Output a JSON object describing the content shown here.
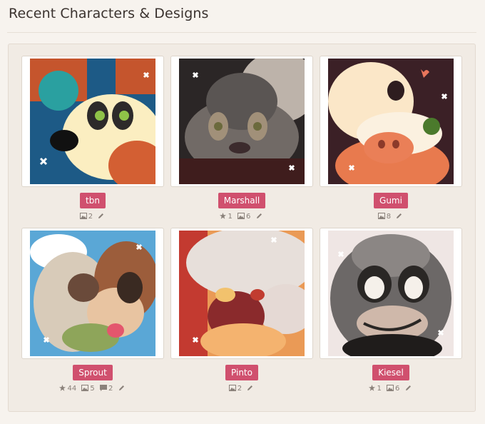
{
  "heading": "Recent Characters & Designs",
  "characters": [
    {
      "name": "tbn",
      "stats": {
        "images": "2"
      }
    },
    {
      "name": "Marshall",
      "stats": {
        "favorites": "1",
        "images": "6"
      }
    },
    {
      "name": "Gumi",
      "stats": {
        "images": "8"
      }
    },
    {
      "name": "Sprout",
      "stats": {
        "favorites": "44",
        "images": "5",
        "comments": "2"
      }
    },
    {
      "name": "Pinto",
      "stats": {
        "images": "2"
      }
    },
    {
      "name": "Kiesel",
      "stats": {
        "favorites": "1",
        "images": "6"
      }
    }
  ],
  "colors": {
    "badge": "#d0506e",
    "panel": "#f1ebe4",
    "stat_text": "#8a817a"
  },
  "icons": [
    "star-icon",
    "image-icon",
    "comment-icon",
    "pencil-icon"
  ]
}
